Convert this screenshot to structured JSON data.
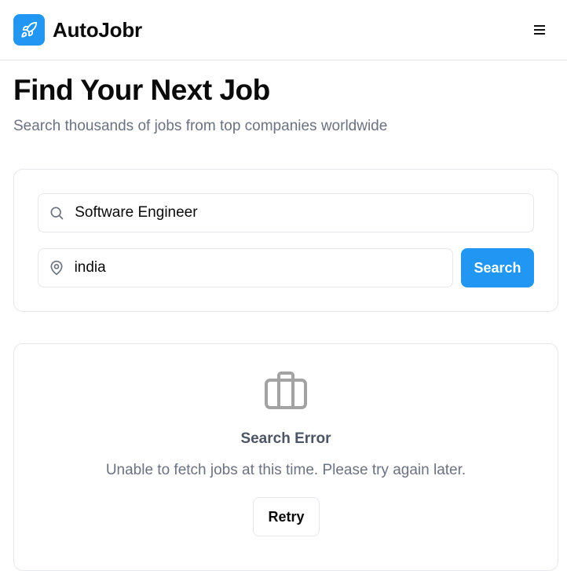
{
  "header": {
    "brand_name": "AutoJobr",
    "logo_icon": "rocket-icon",
    "menu_icon": "hamburger-menu-icon",
    "accent_color": "#2196f3"
  },
  "hero": {
    "title": "Find Your Next Job",
    "subtitle": "Search thousands of jobs from top companies worldwide"
  },
  "search": {
    "keyword_value": "Software Engineer",
    "keyword_icon": "search-icon",
    "location_value": "india",
    "location_icon": "map-pin-icon",
    "button_label": "Search"
  },
  "error": {
    "icon": "briefcase-icon",
    "title": "Search Error",
    "message": "Unable to fetch jobs at this time. Please try again later.",
    "retry_label": "Retry"
  }
}
